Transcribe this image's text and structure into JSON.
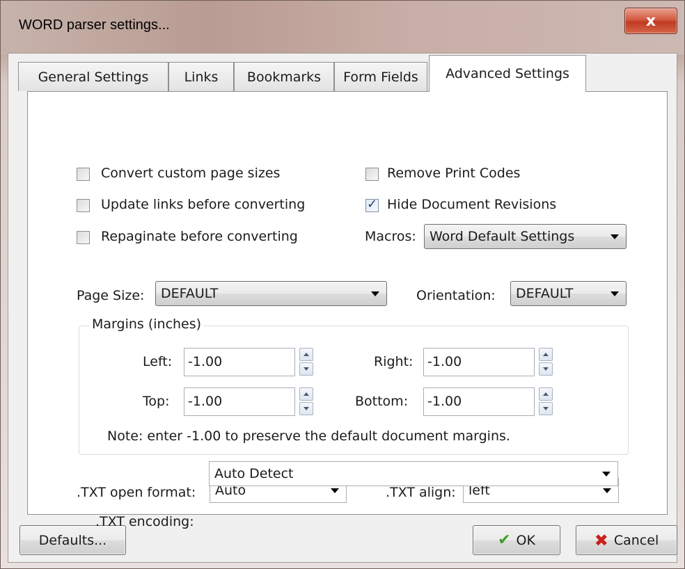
{
  "window": {
    "title": "WORD parser settings...",
    "close_glyph": "x"
  },
  "tabs": [
    {
      "label": "General Settings",
      "active": false
    },
    {
      "label": "Links",
      "active": false
    },
    {
      "label": "Bookmarks",
      "active": false
    },
    {
      "label": "Form Fields",
      "active": false
    },
    {
      "label": "Advanced Settings",
      "active": true
    }
  ],
  "options": {
    "convert_custom_page_sizes": {
      "label": "Convert custom page sizes",
      "checked": false
    },
    "update_links": {
      "label": "Update links before converting",
      "checked": false
    },
    "repaginate": {
      "label": "Repaginate before converting",
      "checked": false
    },
    "remove_print_codes": {
      "label": "Remove Print Codes",
      "checked": false
    },
    "hide_revisions": {
      "label": "Hide Document Revisions",
      "checked": true
    }
  },
  "macros": {
    "label": "Macros:",
    "value": "Word Default Settings"
  },
  "page_size": {
    "label": "Page Size:",
    "value": "DEFAULT"
  },
  "orientation": {
    "label": "Orientation:",
    "value": "DEFAULT"
  },
  "margins": {
    "group_label": "Margins (inches)",
    "left": {
      "label": "Left:",
      "value": "-1.00"
    },
    "right": {
      "label": "Right:",
      "value": "-1.00"
    },
    "top": {
      "label": "Top:",
      "value": "-1.00"
    },
    "bottom": {
      "label": "Bottom:",
      "value": "-1.00"
    },
    "note": "Note: enter -1.00 to preserve the default document margins."
  },
  "txt": {
    "open_format_label": ".TXT open format:",
    "open_format_value": "Auto",
    "align_label": ".TXT align:",
    "align_value": "left",
    "encoding_label": ".TXT encoding:",
    "encoding_value": "Auto Detect"
  },
  "buttons": {
    "defaults": "Defaults...",
    "ok": "OK",
    "cancel": "Cancel"
  },
  "icons": {
    "checkmark": "✓",
    "ok": "✔",
    "cancel": "✖"
  },
  "colors": {
    "title_bar": "#c1a69d",
    "close_button": "#d45a40",
    "ok_icon": "#3f9d2b",
    "cancel_icon": "#c8201a"
  }
}
